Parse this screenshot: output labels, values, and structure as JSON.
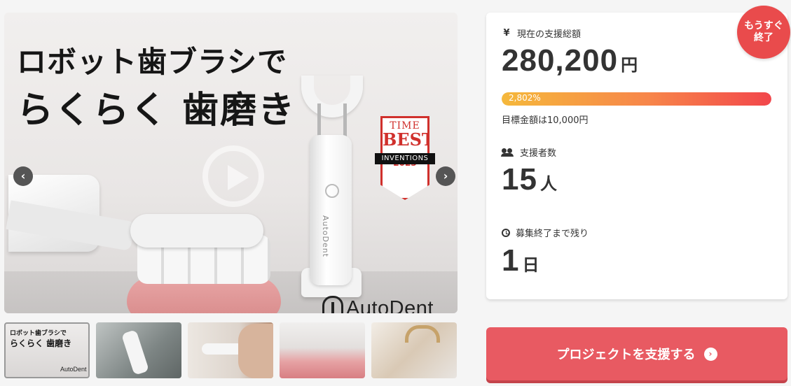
{
  "hero": {
    "title_line1": "ロボット歯ブラシで",
    "title_line2": "らくらく 歯磨き",
    "device_label": "AutoDent",
    "badge_time": "TIME",
    "badge_best": "BEST",
    "badge_inventions": "INVENTIONS",
    "badge_year": "2023",
    "brand_name": "AutoDent",
    "prev_icon": "chevron-left-icon",
    "next_icon": "chevron-right-icon",
    "prev_glyph": "‹",
    "next_glyph": "›"
  },
  "thumbnails": [
    {
      "title_a": "ロボット歯ブラシで",
      "title_b": "らくらく 歯磨き",
      "logo": "AutoDent"
    },
    {},
    {},
    {},
    {}
  ],
  "funding": {
    "total_label": "現在の支援総額",
    "total_value": "280,200",
    "total_unit": "円",
    "progress_text": "2,802%",
    "progress_fraction": 1.0,
    "goal_text": "目標金額は10,000円",
    "supporters_label": "支援者数",
    "supporters_value": "15",
    "supporters_unit": "人",
    "remaining_label": "募集終了まで残り",
    "remaining_value": "1",
    "remaining_unit": "日",
    "yen_icon": "¥"
  },
  "badge": {
    "line1": "もうすぐ",
    "line2": "終了"
  },
  "support_button": {
    "label": "プロジェクトを支援する",
    "icon_glyph": "›"
  },
  "colors": {
    "accent": "#e85a62",
    "badge": "#e94b4c",
    "progress_start": "#f5b83b",
    "progress_end": "#f2464b"
  }
}
